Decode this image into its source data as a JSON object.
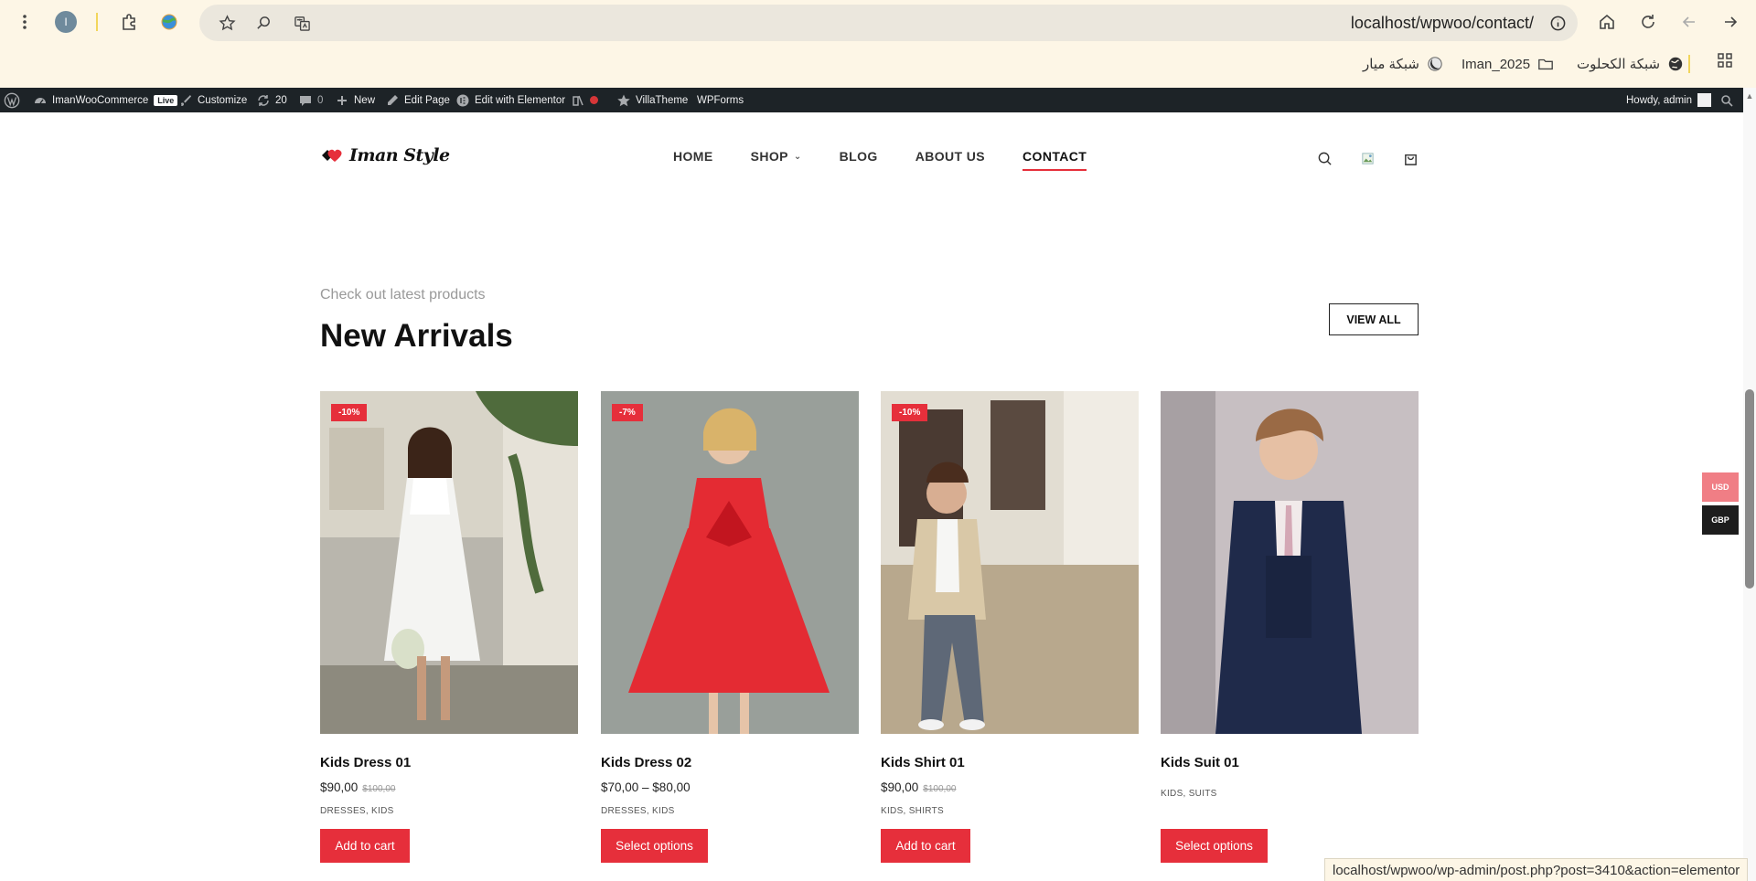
{
  "browser": {
    "url": "localhost/wpwoo/contact/",
    "profile_initial": "I",
    "bookmarks": [
      {
        "label": "شبكة الكحلوت",
        "icon": "globe-icon"
      },
      {
        "label": "Iman_2025",
        "icon": "folder-icon"
      },
      {
        "label": "شبكة ميار",
        "icon": "moon-icon"
      }
    ],
    "status_url": "localhost/wpwoo/wp-admin/post.php?post=3410&action=elementor"
  },
  "admin_bar": {
    "site_name": "ImanWooCommerce",
    "live_badge": "Live",
    "customize": "Customize",
    "updates_count": "20",
    "comments_count": "0",
    "new": "New",
    "edit_page": "Edit Page",
    "edit_elementor": "Edit with Elementor",
    "villatheme": "VillaTheme",
    "wpforms": "WPForms",
    "howdy": "Howdy, admin"
  },
  "site": {
    "logo_text": "Iman Style",
    "nav": [
      {
        "label": "HOME"
      },
      {
        "label": "SHOP"
      },
      {
        "label": "BLOG"
      },
      {
        "label": "ABOUT US"
      },
      {
        "label": "CONTACT"
      }
    ]
  },
  "section": {
    "eyebrow": "Check out latest products",
    "title": "New Arrivals",
    "view_all": "VIEW ALL"
  },
  "products": [
    {
      "name": "Kids Dress 01",
      "badge": "-10%",
      "price": "$90,00",
      "old_price": "$100,00",
      "categories": "DRESSES, KIDS",
      "button": "Add to cart"
    },
    {
      "name": "Kids Dress 02",
      "badge": "-7%",
      "price": "$70,00 – $80,00",
      "old_price": "",
      "categories": "DRESSES, KIDS",
      "button": "Select options"
    },
    {
      "name": "Kids Shirt 01",
      "badge": "-10%",
      "price": "$90,00",
      "old_price": "$100,00",
      "categories": "KIDS, SHIRTS",
      "button": "Add to cart"
    },
    {
      "name": "Kids Suit 01",
      "badge": "",
      "price": "",
      "old_price": "",
      "categories": "KIDS, SUITS",
      "button": "Select options"
    }
  ],
  "currency": {
    "options": [
      "USD",
      "GBP"
    ],
    "selected": "USD"
  },
  "colors": {
    "accent": "#e62f3b",
    "admin_bar": "#1d2327",
    "chrome_bg": "#fdf6e6"
  }
}
